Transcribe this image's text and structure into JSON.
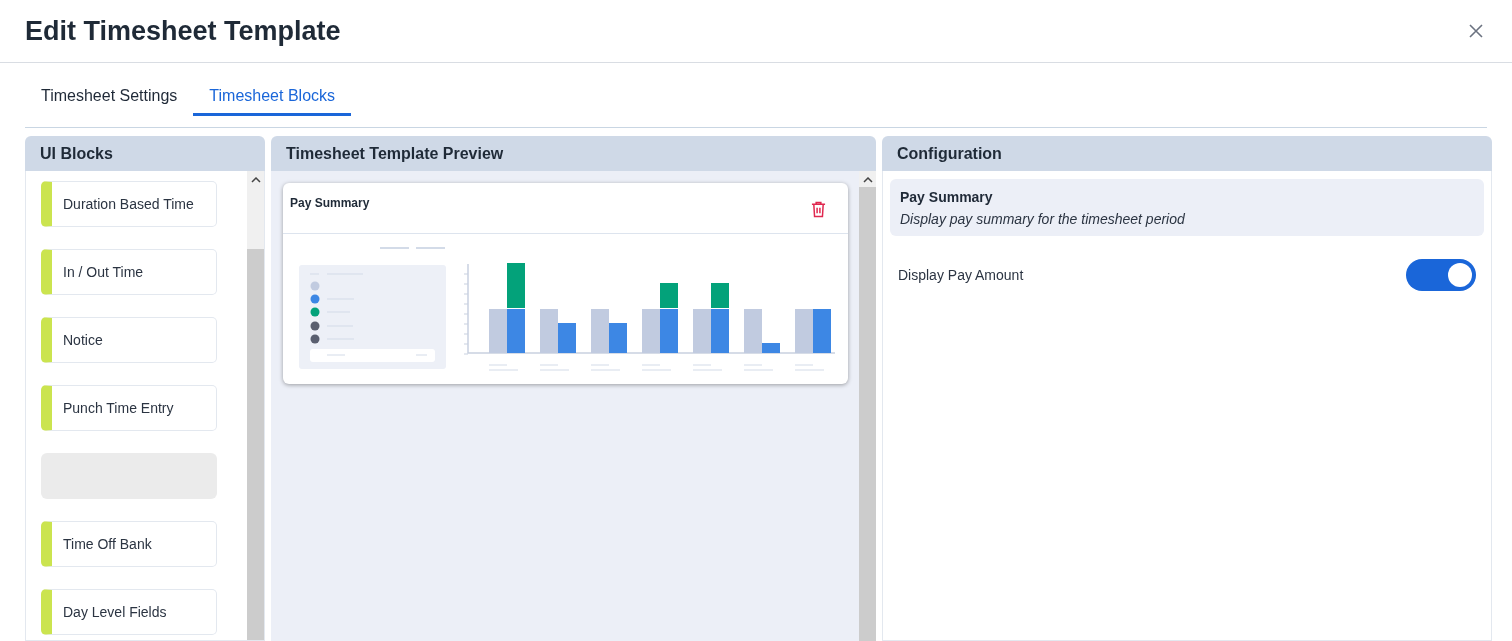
{
  "dialog": {
    "title": "Edit Timesheet Template"
  },
  "tabs": [
    {
      "label": "Timesheet Settings",
      "selected": false
    },
    {
      "label": "Timesheet Blocks",
      "selected": true
    }
  ],
  "ui_blocks": {
    "title": "UI Blocks",
    "items": [
      {
        "kind": "block",
        "label": "Duration Based Time"
      },
      {
        "kind": "block",
        "label": "In / Out Time"
      },
      {
        "kind": "block",
        "label": "Notice"
      },
      {
        "kind": "block",
        "label": "Punch Time Entry"
      },
      {
        "kind": "placeholder"
      },
      {
        "kind": "block",
        "label": "Time Off Bank"
      },
      {
        "kind": "block",
        "label": "Day Level Fields"
      }
    ]
  },
  "preview": {
    "title": "Timesheet Template Preview",
    "cards": [
      {
        "title": "Pay Summary"
      }
    ]
  },
  "configuration": {
    "title": "Configuration",
    "block_title": "Pay Summary",
    "block_description": "Display pay summary for the timesheet period",
    "options": [
      {
        "label": "Display Pay Amount",
        "on": true
      }
    ]
  }
}
